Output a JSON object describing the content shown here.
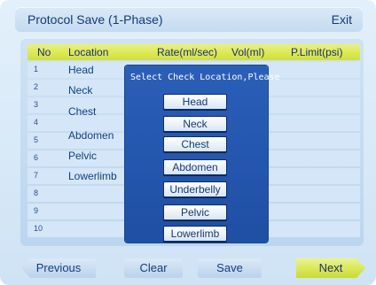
{
  "title": "Protocol Save (1-Phase)",
  "exit_label": "Exit",
  "table": {
    "headers": [
      "No",
      "Location",
      "Rate(ml/sec)",
      "Vol(ml)",
      "P.Limit(psi)"
    ],
    "rows": [
      {
        "no": "1",
        "location": "Head"
      },
      {
        "no": "2",
        "location": "Neck"
      },
      {
        "no": "3",
        "location": "Chest"
      },
      {
        "no": "4",
        "location": ""
      },
      {
        "no": "5",
        "location": "Abdomen"
      },
      {
        "no": "6",
        "location": "Pelvic"
      },
      {
        "no": "7",
        "location": "Lowerlimb"
      },
      {
        "no": "8",
        "location": ""
      },
      {
        "no": "9",
        "location": ""
      },
      {
        "no": "10",
        "location": ""
      }
    ]
  },
  "popup": {
    "title": "Select Check Location,Please",
    "options": [
      "Head",
      "Neck",
      "Chest",
      "Abdomen",
      "Underbelly",
      "Pelvic",
      "Lowerlimb"
    ]
  },
  "footer": {
    "previous": "Previous",
    "clear": "Clear",
    "save": "Save",
    "next": "Next"
  },
  "colors": {
    "header_row": "#cfe138",
    "popup_bg": "#2a5fb8",
    "title_text": "#123a78"
  }
}
